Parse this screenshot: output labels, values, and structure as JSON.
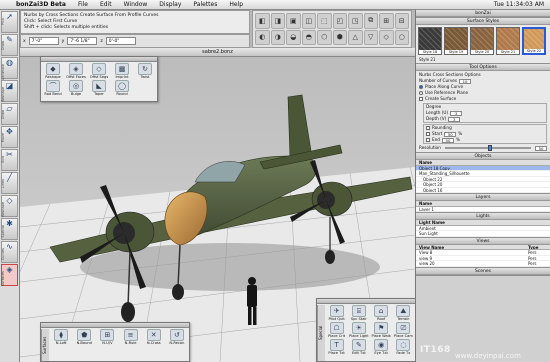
{
  "menubar": {
    "app_name": "bonZai3D Beta",
    "menus": [
      "File",
      "Edit",
      "Window",
      "Display",
      "Palettes",
      "Help"
    ],
    "clock": "Tue 11:34:03 AM"
  },
  "prompt": {
    "line1": "Nurbs by Cross Sections  Create Surface From Profile Curves",
    "line2": "Click: Select First Curve",
    "line3": "Shift + click: Selects multiple entities"
  },
  "coords": {
    "x_value": "7'-0\"",
    "y_value": "7'-6 1/8\"",
    "z_value": "0'-0\""
  },
  "viewport": {
    "title": "sabre2.bonz"
  },
  "left_tools": [
    {
      "label": "Pick",
      "glyph": "➚"
    },
    {
      "label": "Draw",
      "glyph": "✎"
    },
    {
      "label": "Generate",
      "glyph": "◍"
    },
    {
      "label": "Reshape",
      "glyph": "◪"
    },
    {
      "label": "Draw",
      "glyph": "▱"
    },
    {
      "label": "Move",
      "glyph": "✥"
    },
    {
      "label": "Edit",
      "glyph": "✂"
    },
    {
      "label": "Lines",
      "glyph": "╱"
    },
    {
      "label": "Reshape",
      "glyph": "◇"
    },
    {
      "label": "Special",
      "glyph": "✱"
    },
    {
      "label": "Curves",
      "glyph": "∿"
    },
    {
      "label": "Surfaces",
      "glyph": "◈"
    }
  ],
  "reshape_palette": {
    "buttons": [
      "Reshape",
      "Offst Faces",
      "Offst Segs",
      "Imprint",
      "Twist",
      "Rad Bend",
      "Bulge",
      "Taper",
      "Round"
    ]
  },
  "surfaces_palette": {
    "label": "Surfaces",
    "buttons": [
      "N-Loft",
      "N-Bound",
      "N-U/V",
      "N-Rule",
      "N-Cross",
      "N-Recon"
    ]
  },
  "special_palette": {
    "label": "Special",
    "buttons": [
      "Pilot Quit",
      "Spc Stair",
      "Roof",
      "Terrain",
      "Place Crit",
      "Place Light",
      "Place Walk",
      "Place Cam",
      "Place Txt",
      "Edit Txt",
      "Eye Txt",
      "Fade Tx"
    ]
  },
  "right_panel": {
    "title": "bonZai",
    "surface_styles": {
      "header": "Surface Styles",
      "swatches": [
        {
          "name": "Style 18",
          "color": "#3a3a3a",
          "selected": false
        },
        {
          "name": "Style 19",
          "color": "#7a5a36",
          "selected": false
        },
        {
          "name": "Style 20",
          "color": "#8a6440",
          "selected": false
        },
        {
          "name": "Style 21",
          "color": "#b07a4c",
          "selected": false
        },
        {
          "name": "Style 22",
          "color": "#d29a5a",
          "selected": true
        }
      ],
      "current": "Style 21"
    },
    "tool_options": {
      "header": "Tool Options",
      "subtitle": "Nurbs Cross Sections Options",
      "num_curves_label": "Number of Curves",
      "num_curves_value": "10",
      "radio_place_along": "Place Along Curve",
      "radio_use_ref": "Use Reference Plane",
      "create_surface": "Create Surface",
      "degree_label": "Degree",
      "length_label": "Length (U)",
      "length_value": "3",
      "depth_label": "Depth (V)",
      "depth_value": "3",
      "rounding_label": "Rounding",
      "start_label": "Start",
      "start_value": "50",
      "end_label": "End",
      "end_value": "50",
      "pct": "%",
      "resolution_label": "Resolution",
      "resolution_value": "50"
    },
    "objects": {
      "header": "Objects",
      "column": "Name",
      "rows": [
        "Object 18 Copy",
        "Man_Standing_Silhouette",
        "Object 22",
        "Object 20",
        "Object 16"
      ],
      "selected_index": 0
    },
    "layers": {
      "header": "Layers",
      "column": "Name",
      "rows": [
        "Layer 1"
      ]
    },
    "lights": {
      "header": "Lights",
      "column": "Light Name",
      "rows": [
        "Ambient",
        "Sun Light"
      ]
    },
    "views": {
      "header": "Views",
      "columns": [
        "View Name",
        "Type"
      ],
      "rows": [
        {
          "name": "View 8",
          "type": "Pers"
        },
        {
          "name": "view 9",
          "type": "Pers"
        },
        {
          "name": "view 20",
          "type": "Pers"
        }
      ]
    },
    "scenes": {
      "header": "Scenes"
    }
  },
  "watermark": {
    "text1": "IT168",
    "text2": "www.deyinpai.com"
  }
}
